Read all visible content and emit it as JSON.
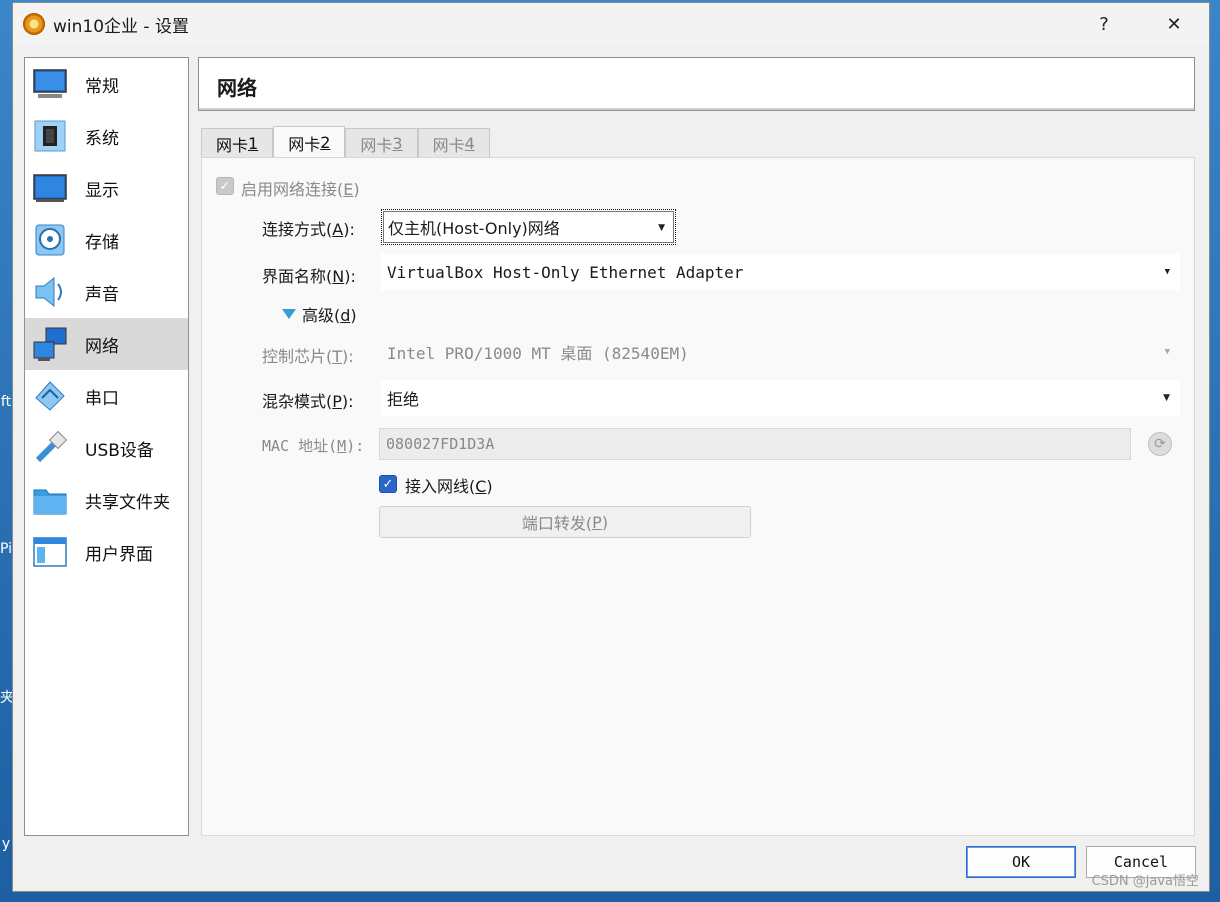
{
  "window": {
    "title": "win10企业 - 设置",
    "help": "?",
    "close": "✕"
  },
  "sidebar": {
    "items": [
      {
        "label": "常规",
        "icon": "monitor-icon"
      },
      {
        "label": "系统",
        "icon": "chip-icon"
      },
      {
        "label": "显示",
        "icon": "display-icon"
      },
      {
        "label": "存储",
        "icon": "disk-icon"
      },
      {
        "label": "声音",
        "icon": "speaker-icon"
      },
      {
        "label": "网络",
        "icon": "network-icon",
        "selected": true
      },
      {
        "label": "串口",
        "icon": "serial-port-icon"
      },
      {
        "label": "USB设备",
        "icon": "usb-icon"
      },
      {
        "label": "共享文件夹",
        "icon": "folder-icon"
      },
      {
        "label": "用户界面",
        "icon": "ui-window-icon"
      }
    ]
  },
  "header": {
    "title": "网络"
  },
  "tabs": [
    {
      "label": "网卡 ",
      "key": "1",
      "active": false,
      "disabled": false
    },
    {
      "label": "网卡 ",
      "key": "2",
      "active": true,
      "disabled": false
    },
    {
      "label": "网卡 ",
      "key": "3",
      "active": false,
      "disabled": true
    },
    {
      "label": "网卡 ",
      "key": "4",
      "active": false,
      "disabled": true
    }
  ],
  "form": {
    "enable": {
      "label": "启用网络连接(",
      "key": "E",
      "suffix": ")",
      "checked": true,
      "disabled": true
    },
    "attached_to": {
      "label": "连接方式(",
      "key": "A",
      "suffix": "):",
      "value": "仅主机(Host-Only)网络"
    },
    "name": {
      "label": "界面名称(",
      "key": "N",
      "suffix": "):",
      "value": "VirtualBox Host-Only Ethernet Adapter"
    },
    "advanced": {
      "label": "高级(",
      "key": "d",
      "suffix": ")"
    },
    "adapter_type": {
      "label": "控制芯片(",
      "key": "T",
      "suffix": "):",
      "value": "Intel PRO/1000 MT 桌面 (82540EM)"
    },
    "promiscuous": {
      "label": "混杂模式(",
      "key": "P",
      "suffix": "):",
      "value": "拒绝"
    },
    "mac": {
      "label": "MAC 地址(",
      "key": "M",
      "suffix": "):",
      "value": "080027FD1D3A"
    },
    "cable": {
      "label": "接入网线(",
      "key": "C",
      "suffix": ")",
      "checked": true
    },
    "port_forwarding": {
      "label": "端口转发(",
      "key": "P",
      "suffix": ")"
    }
  },
  "footer": {
    "ok": "OK",
    "cancel": "Cancel"
  },
  "watermark": "CSDN @java悟空",
  "desktop_fragments": [
    "ft",
    "Pi",
    "夹",
    "y"
  ],
  "colors": {
    "selected": "#d9d9d9",
    "accent": "#2b67c9",
    "triangle": "#3b9ad9"
  }
}
